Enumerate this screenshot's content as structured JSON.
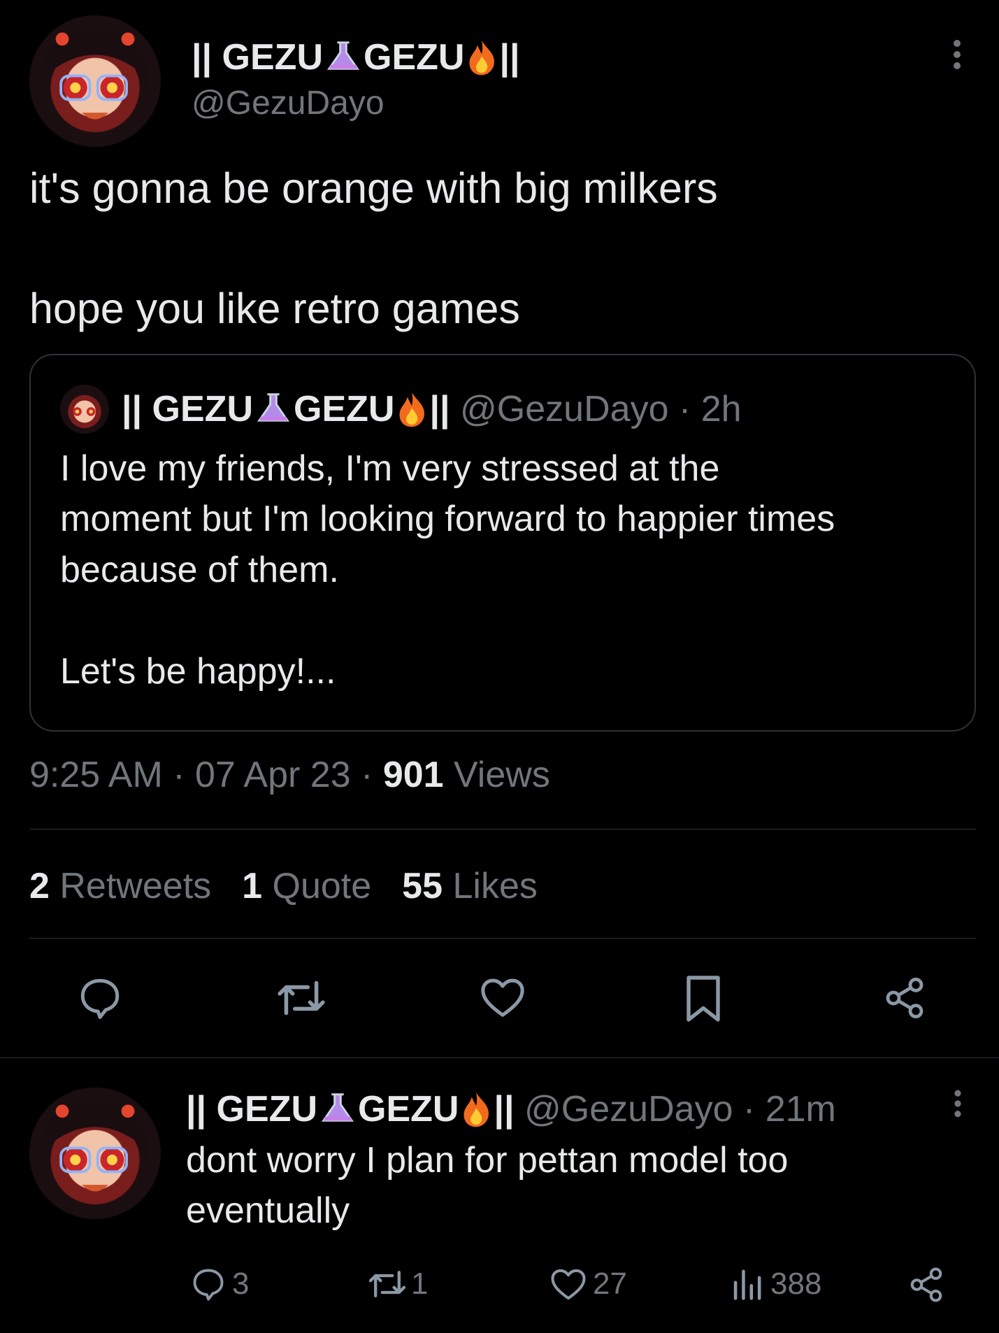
{
  "main_tweet": {
    "display_name_prefix": "|| GEZU",
    "display_name_mid": "GEZU",
    "display_name_suffix": "||",
    "handle": "@GezuDayo",
    "text_line1": "it's gonna be orange with big milkers",
    "text_line2": "hope you like retro games",
    "quote": {
      "display_name_prefix": "|| GEZU",
      "display_name_mid": "GEZU",
      "display_name_suffix": "||",
      "handle_time": "@GezuDayo · 2h",
      "text_line1": "I love my friends, I'm very stressed at the",
      "text_line2": "moment but I'm looking forward to happier times",
      "text_line3": "because of them.",
      "text_line4": "Let's be happy!..."
    },
    "meta_time": "9:25 AM · 07 Apr 23 · ",
    "views_count": "901",
    "views_label": " Views",
    "stats": {
      "retweets_count": "2",
      "retweets_label": "Retweets",
      "quotes_count": "1",
      "quotes_label": "Quote",
      "likes_count": "55",
      "likes_label": "Likes"
    }
  },
  "reply": {
    "display_name_prefix": "|| GEZU",
    "display_name_mid": "GEZU",
    "display_name_suffix": "||",
    "handle_time": "@GezuDayo · 21m",
    "text_line1": "dont worry I plan for pettan model too",
    "text_line2": "eventually",
    "reply_count": "3",
    "retweet_count": "1",
    "like_count": "27",
    "views_count": "388"
  },
  "colors": {
    "background": "#000000",
    "text": "#e7e9ea",
    "muted": "#71767b",
    "divider": "#2f3336"
  },
  "icons": [
    "more-icon",
    "flask-icon",
    "fire-icon",
    "reply-icon",
    "retweet-icon",
    "like-icon",
    "bookmark-icon",
    "share-icon",
    "views-icon"
  ]
}
